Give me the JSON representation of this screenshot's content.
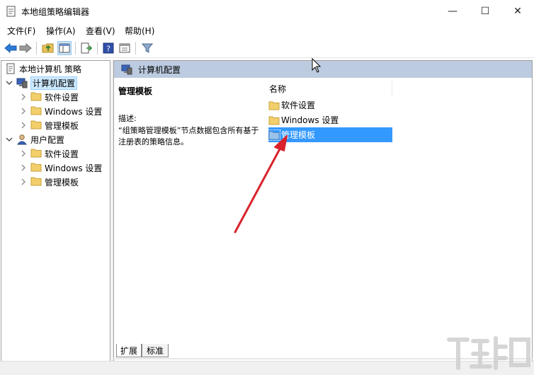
{
  "window": {
    "title": "本地组策略编辑器",
    "controls": {
      "minimize": "—",
      "maximize": "☐",
      "close": "✕"
    }
  },
  "menu": [
    {
      "label": "文件(F)"
    },
    {
      "label": "操作(A)"
    },
    {
      "label": "查看(V)"
    },
    {
      "label": "帮助(H)"
    }
  ],
  "toolbar": {
    "icons": [
      "back-arrow-icon",
      "forward-arrow-icon",
      "up-folder-icon",
      "show-hide-tree-icon",
      "export-list-icon",
      "help-icon",
      "properties-icon",
      "filter-icon"
    ]
  },
  "tree": {
    "root": "本地计算机 策略",
    "computer_config": "计算机配置",
    "computer_children": [
      "软件设置",
      "Windows 设置",
      "管理模板"
    ],
    "user_config": "用户配置",
    "user_children": [
      "软件设置",
      "Windows 设置",
      "管理模板"
    ]
  },
  "right_pane": {
    "header": "计算机配置",
    "desc_title": "管理模板",
    "desc_label": "描述:",
    "desc_text": "“组策略管理模板”节点数据包含所有基于注册表的策略信息。",
    "column_name": "名称",
    "items": [
      {
        "label": "软件设置",
        "selected": false
      },
      {
        "label": "Windows 设置",
        "selected": false
      },
      {
        "label": "管理模板",
        "selected": true
      }
    ]
  },
  "tabs": {
    "extended": "扩展",
    "standard": "标准"
  },
  "colors": {
    "header_bg": "#bccbe0",
    "selection": "#3399ff",
    "tree_selection": "#cce8ff",
    "annotation_arrow": "#d9232d"
  }
}
